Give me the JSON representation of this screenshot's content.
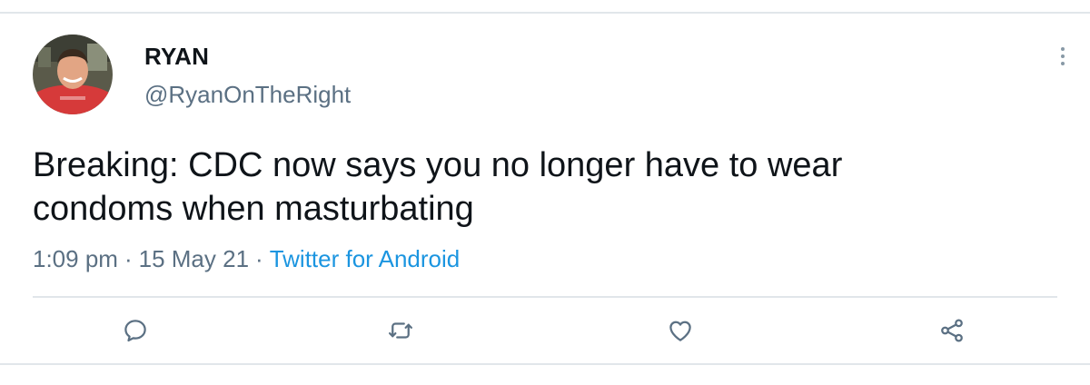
{
  "tweet": {
    "author": {
      "display_name": "RYAN",
      "handle": "@RyanOnTheRight",
      "avatar_icon": "profile-photo"
    },
    "text_line_1": "Breaking: CDC now says you no longer have to wear",
    "text_line_2": "condoms when masturbating",
    "time": "1:09 pm",
    "separator": "·",
    "date": "15 May 21",
    "source": "Twitter for Android"
  },
  "actions": [
    {
      "name": "reply",
      "icon": "reply-icon"
    },
    {
      "name": "retweet",
      "icon": "retweet-icon"
    },
    {
      "name": "like",
      "icon": "like-icon"
    },
    {
      "name": "share",
      "icon": "share-icon"
    }
  ],
  "colors": {
    "text_primary": "#0f1419",
    "text_secondary": "#5b7083",
    "link": "#1b95e0",
    "divider": "#e1e6ea"
  }
}
